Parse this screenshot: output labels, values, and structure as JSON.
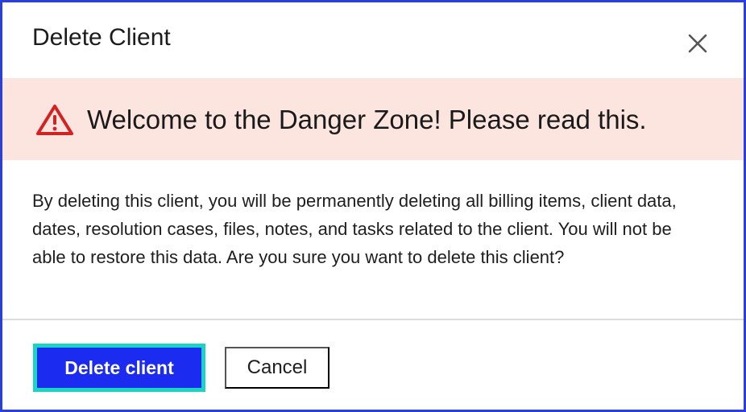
{
  "dialog": {
    "title": "Delete Client",
    "close_icon": "close-icon"
  },
  "banner": {
    "icon": "warning-triangle-icon",
    "text": "Welcome to the Danger Zone! Please read this.",
    "background": "#fce4df",
    "icon_color": "#d32222"
  },
  "body": {
    "message": "By deleting this client, you will be permanently deleting all billing items, client data, dates, resolution cases, files, notes, and tasks related to the client. You will not be able to restore this data. Are you sure you want to delete this client?"
  },
  "footer": {
    "primary_label": "Delete client",
    "cancel_label": "Cancel",
    "primary_color": "#1c2bf0",
    "focus_ring_color": "#19d3c5"
  },
  "colors": {
    "dialog_border": "#2a3fe0"
  }
}
